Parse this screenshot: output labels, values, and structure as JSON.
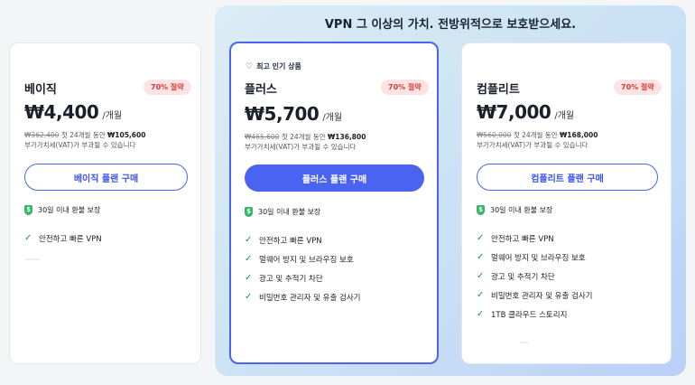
{
  "promo": {
    "title": "VPN 그 이상의 가치. 전방위적으로 보호받으세요."
  },
  "plans": [
    {
      "name": "베이직",
      "badge": "70% 절약",
      "price": "₩4,400",
      "per": "/개월",
      "old_price": "₩362,400",
      "term": " 첫 24개월 동안 ",
      "total": "₩105,600",
      "vat": "부가가치세(VAT)가 부과될 수 있습니다",
      "button": "베이직 플랜 구매",
      "guarantee": "30일 이내 환불 보장",
      "features": [
        "안전하고 빠른 VPN"
      ]
    },
    {
      "popular": "최고 인기 상품",
      "name": "플러스",
      "badge": "70% 절약",
      "price": "₩5,700",
      "per": "/개월",
      "old_price": "₩465,600",
      "term": " 첫 24개월 동안 ",
      "total": "₩136,800",
      "vat": "부가가치세(VAT)가 부과될 수 있습니다",
      "button": "플러스 플랜 구매",
      "guarantee": "30일 이내 환불 보장",
      "features": [
        "안전하고 빠른 VPN",
        "멀웨어 방지 및 브라우징 보호",
        "광고 및 추적기 차단",
        "비밀번호 관리자 및 유출 검사기"
      ]
    },
    {
      "name": "컴플리트",
      "badge": "70% 절약",
      "price": "₩7,000",
      "per": "/개월",
      "old_price": "₩560,000",
      "term": " 첫 24개월 동안 ",
      "total": "₩168,000",
      "vat": "부가가치세(VAT)가 부과될 수 있습니다",
      "button": "컴플리트 플랜 구매",
      "guarantee": "30일 이내 환불 보장",
      "features": [
        "안전하고 빠른 VPN",
        "멀웨어 방지 및 브라우징 보호",
        "광고 및 추적기 차단",
        "비밀번호 관리자 및 유출 검사기",
        "1TB 클라우드 스토리지"
      ]
    }
  ],
  "colors": {
    "accent": "#4a63f0",
    "badge_bg": "#fde3e3",
    "badge_text": "#d93a3a",
    "check": "#1e8c5a",
    "shield": "#2fb866"
  }
}
